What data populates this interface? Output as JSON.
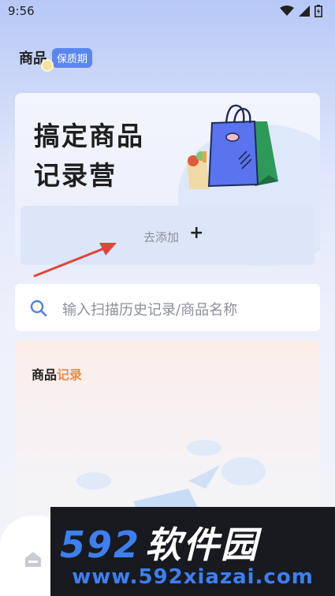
{
  "status_bar": {
    "time": "9:56"
  },
  "header": {
    "title": "商品",
    "badge": "保质期"
  },
  "hero": {
    "title_line1": "搞定商品",
    "title_line2": "记录营",
    "add_label": "去添加",
    "add_symbol": "+"
  },
  "search": {
    "placeholder": "输入扫描历史记录/商品名称"
  },
  "records": {
    "title_prefix": "商品",
    "title_highlight": "记录"
  },
  "watermark": {
    "logo_number": "592",
    "logo_text": "软件园",
    "url": "www.592xiazai.com"
  },
  "colors": {
    "accent_blue": "#5b86f0",
    "highlight_orange": "#f08a3c",
    "arrow_red": "#e0443a"
  },
  "icons": [
    "wifi-icon",
    "signal-icon",
    "battery-icon",
    "shopping-bag-icon",
    "search-icon",
    "home-icon",
    "arrow-annotation-icon"
  ]
}
